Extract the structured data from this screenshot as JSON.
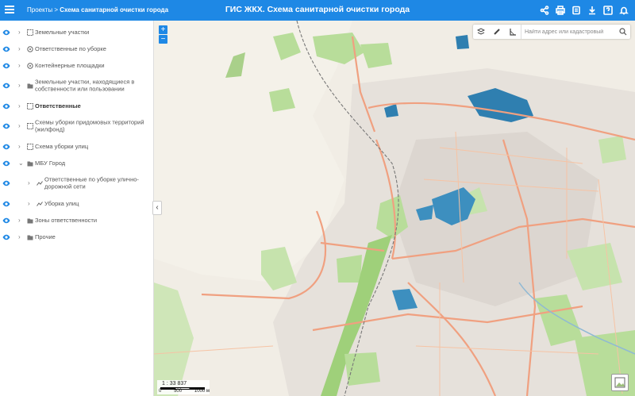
{
  "header": {
    "breadcrumb_root": "Проекты",
    "breadcrumb_sep": ">",
    "breadcrumb_current": "Схема санитарной очистки города",
    "title": "ГИС ЖКХ. Схема санитарной очистки города",
    "icons": [
      "share-icon",
      "print-icon",
      "info-icon",
      "download-icon",
      "help-icon",
      "bell-icon"
    ]
  },
  "sidebar": {
    "layers": [
      {
        "label": "Земельные участки"
      },
      {
        "label": "Ответственные по уборке"
      },
      {
        "label": "Контейнерные площадки"
      },
      {
        "label": "Земельные участки, находящиеся в собственности или пользовании"
      },
      {
        "label": "Ответственные"
      },
      {
        "label": "Схемы уборки придомовых территорий (жилфонд)"
      },
      {
        "label": "Схема уборки улиц"
      },
      {
        "label": "МБУ Город"
      },
      {
        "label": "Ответственные по уборке улично-дорожной сети"
      },
      {
        "label": "Уборка улиц"
      },
      {
        "label": "Зоны ответственности"
      },
      {
        "label": "Прочие"
      }
    ]
  },
  "map": {
    "zoom_in": "+",
    "zoom_out": "−",
    "search_placeholder": "Найти адрес или кадастровый",
    "scale_ratio": "1 : 33 837",
    "scale_ticks": [
      "0",
      "500",
      "1000 м"
    ],
    "colors": {
      "accent": "#1e88e5",
      "water": "#2f7fb0",
      "green": "#b8dd9a",
      "road": "#f0a080"
    }
  }
}
